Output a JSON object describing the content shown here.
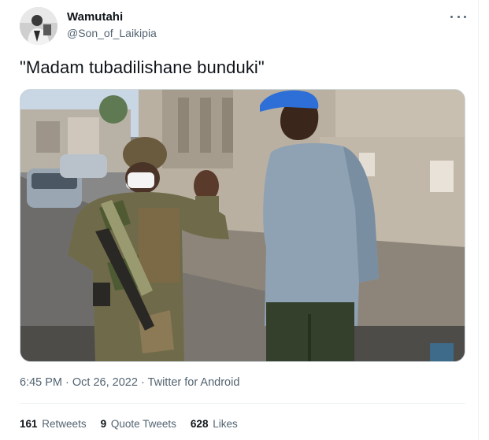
{
  "tweet": {
    "display_name": "Wamutahi",
    "handle": "@Son_of_Laikipia",
    "text": "\"Madam tubadilishane bunduki\"",
    "time": "6:45 PM",
    "separator": " · ",
    "date": "Oct 26, 2022",
    "source": "Twitter for Android"
  },
  "stats": {
    "retweets_count": "161",
    "retweets_label": "Retweets",
    "quotes_count": "9",
    "quotes_label": "Quote Tweets",
    "likes_count": "628",
    "likes_label": "Likes"
  },
  "icons": {
    "more": "more-options-icon"
  }
}
